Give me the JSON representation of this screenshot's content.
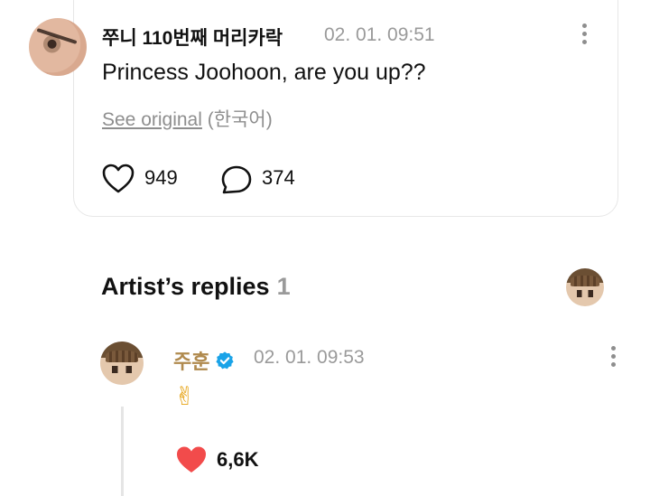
{
  "post": {
    "author": "쭈니 110번째 머리카락",
    "time": "02. 01. 09:51",
    "text": "Princess Joohoon, are you up??",
    "see_original_label": "See original",
    "original_language": "(한국어)",
    "likes": "949",
    "comments": "374",
    "icons": {
      "avatar": "user-avatar",
      "more": "more-vertical-icon",
      "like": "heart-outline-icon",
      "comment": "speech-bubble-icon"
    }
  },
  "artist_replies": {
    "title": "Artist’s replies",
    "count": "1",
    "reply": {
      "author": "주훈",
      "time": "02. 01. 09:53",
      "content": "✌",
      "likes": "6,6K",
      "icons": {
        "verified": "verified-badge-icon",
        "more": "more-vertical-icon",
        "like": "heart-filled-icon"
      }
    }
  },
  "colors": {
    "artist_name": "#b08a4e",
    "verified": "#1aa3e8",
    "heart_filled": "#f24b4b",
    "muted_text": "#9a9a9a"
  }
}
